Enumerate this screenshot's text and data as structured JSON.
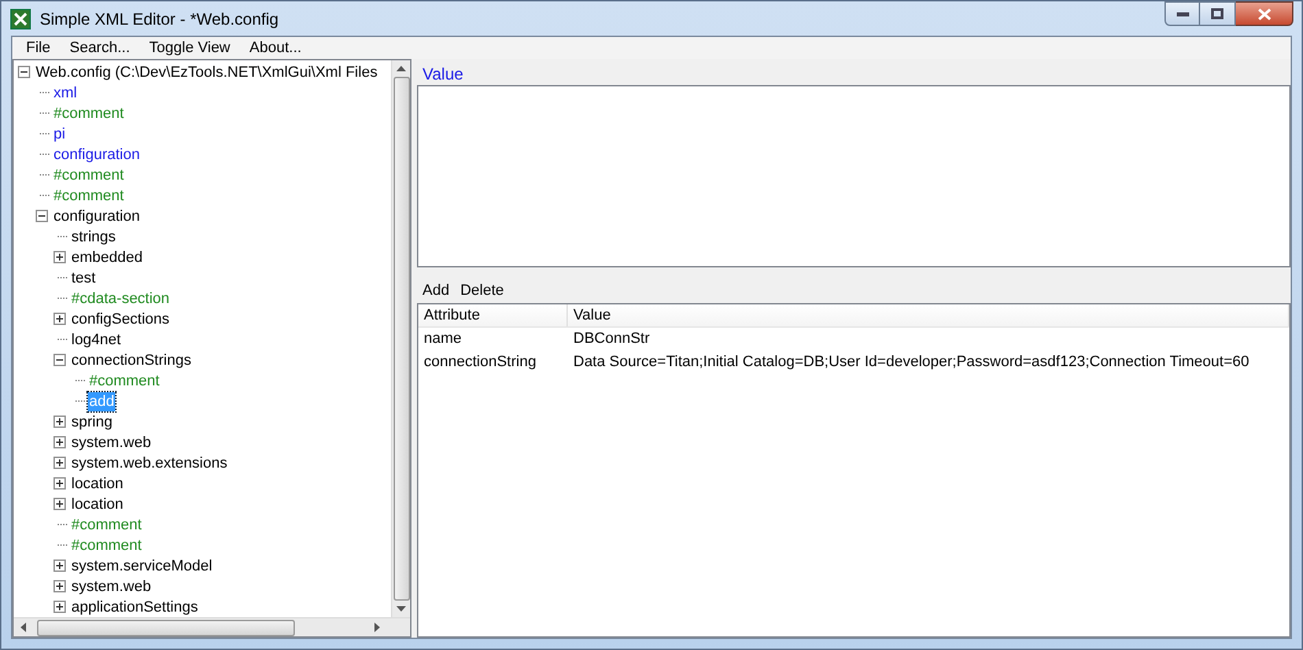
{
  "window": {
    "title": "Simple XML Editor - *Web.config"
  },
  "menu": [
    "File",
    "Search...",
    "Toggle View",
    "About..."
  ],
  "tree": [
    {
      "label": "Web.config (C:\\Dev\\EzTools.NET\\XmlGui\\Xml Files",
      "kind": "element",
      "selected": false,
      "expanded": true,
      "children": [
        {
          "label": "xml",
          "kind": "declaration",
          "selected": false
        },
        {
          "label": "#comment",
          "kind": "comment",
          "selected": false
        },
        {
          "label": "pi",
          "kind": "declaration",
          "selected": false
        },
        {
          "label": "configuration",
          "kind": "declaration",
          "selected": false
        },
        {
          "label": "#comment",
          "kind": "comment",
          "selected": false
        },
        {
          "label": "#comment",
          "kind": "comment",
          "selected": false
        },
        {
          "label": "configuration",
          "kind": "element",
          "selected": false,
          "expanded": true,
          "children": [
            {
              "label": "strings",
              "kind": "element",
              "selected": false
            },
            {
              "label": "embedded",
              "kind": "element",
              "selected": false,
              "expanded": false
            },
            {
              "label": "test",
              "kind": "element",
              "selected": false
            },
            {
              "label": "#cdata-section",
              "kind": "comment",
              "selected": false
            },
            {
              "label": "configSections",
              "kind": "element",
              "selected": false,
              "expanded": false
            },
            {
              "label": "log4net",
              "kind": "element",
              "selected": false
            },
            {
              "label": "connectionStrings",
              "kind": "element",
              "selected": false,
              "expanded": true,
              "children": [
                {
                  "label": "#comment",
                  "kind": "comment",
                  "selected": false
                },
                {
                  "label": "add",
                  "kind": "element",
                  "selected": true
                }
              ]
            },
            {
              "label": "spring",
              "kind": "element",
              "selected": false,
              "expanded": false
            },
            {
              "label": "system.web",
              "kind": "element",
              "selected": false,
              "expanded": false
            },
            {
              "label": "system.web.extensions",
              "kind": "element",
              "selected": false,
              "expanded": false
            },
            {
              "label": "location",
              "kind": "element",
              "selected": false,
              "expanded": false
            },
            {
              "label": "location",
              "kind": "element",
              "selected": false,
              "expanded": false
            },
            {
              "label": "#comment",
              "kind": "comment",
              "selected": false
            },
            {
              "label": "#comment",
              "kind": "comment",
              "selected": false
            },
            {
              "label": "system.serviceModel",
              "kind": "element",
              "selected": false,
              "expanded": false
            },
            {
              "label": "system.web",
              "kind": "element",
              "selected": false,
              "expanded": false
            },
            {
              "label": "applicationSettings",
              "kind": "element",
              "selected": false,
              "expanded": false
            }
          ]
        }
      ]
    }
  ],
  "value_panel": {
    "label": "Value"
  },
  "attributes": {
    "toolbar": [
      "Add",
      "Delete"
    ],
    "columns": [
      "Attribute",
      "Value"
    ],
    "rows": [
      [
        "name",
        "DBConnStr"
      ],
      [
        "connectionString",
        "Data Source=Titan;Initial Catalog=DB;User Id=developer;Password=asdf123;Connection Timeout=60"
      ]
    ]
  }
}
